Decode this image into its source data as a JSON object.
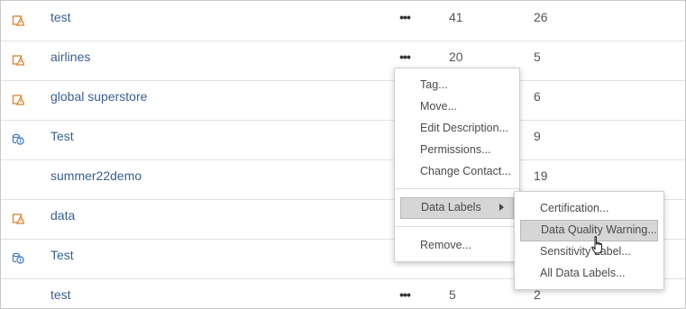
{
  "rows": [
    {
      "name": "test",
      "icon": "workbook-alert-icon",
      "count1": "41",
      "count2": "26",
      "more": "•••"
    },
    {
      "name": "airlines",
      "icon": "workbook-alert-icon",
      "count1": "20",
      "count2": "5",
      "more": "•••"
    },
    {
      "name": "global superstore",
      "icon": "workbook-alert-icon",
      "count1": "",
      "count2": "6",
      "more": ""
    },
    {
      "name": "Test",
      "icon": "datasource-info-icon",
      "count1": "",
      "count2": "9",
      "more": ""
    },
    {
      "name": "summer22demo",
      "icon": "",
      "count1": "",
      "count2": "19",
      "more": ""
    },
    {
      "name": "data",
      "icon": "workbook-alert-icon",
      "count1": "",
      "count2": "",
      "more": ""
    },
    {
      "name": "Test",
      "icon": "datasource-info-icon",
      "count1": "",
      "count2": "",
      "more": ""
    },
    {
      "name": "test",
      "icon": "",
      "count1": "5",
      "count2": "2",
      "more": "•••"
    }
  ],
  "context_menu": {
    "items": [
      "Tag...",
      "Move...",
      "Edit Description...",
      "Permissions...",
      "Change Contact..."
    ],
    "data_labels": "Data Labels",
    "remove": "Remove..."
  },
  "submenu": {
    "items": [
      "Certification...",
      "Data Quality Warning...",
      "Sensitivity Label...",
      "All Data Labels..."
    ],
    "active_index": 1
  },
  "colors": {
    "link": "#3a5f8c",
    "alert_icon": "#d9822b",
    "info_icon": "#3a78b8"
  }
}
